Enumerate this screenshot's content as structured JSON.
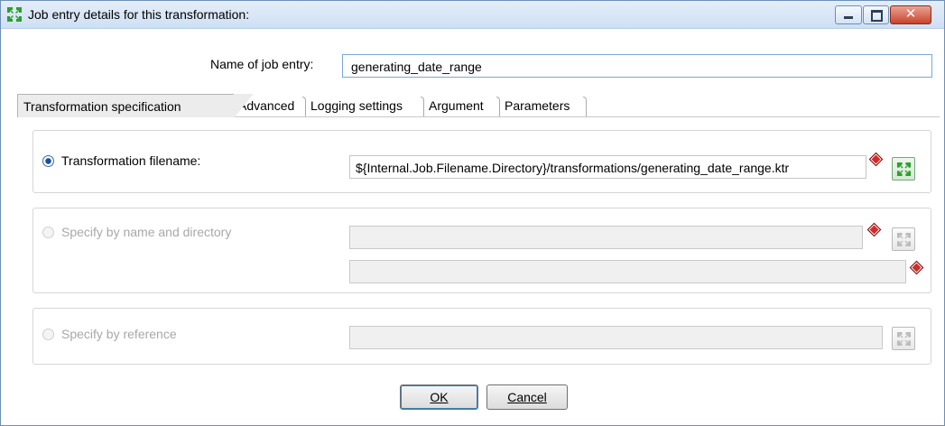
{
  "window": {
    "title": "Job entry details for this transformation:",
    "icon": "job-entry-icon",
    "controls": [
      "minimize-icon",
      "maximize-icon",
      "close-icon"
    ]
  },
  "name_of_job_entry": {
    "label": "Name of job entry:",
    "value": "generating_date_range"
  },
  "tabs": [
    {
      "label": "Transformation specification",
      "active": true
    },
    {
      "label": "Advanced",
      "active": false
    },
    {
      "label": "Logging settings",
      "active": false
    },
    {
      "label": "Argument",
      "active": false
    },
    {
      "label": "Parameters",
      "active": false
    }
  ],
  "spec": {
    "filename_option": {
      "label": "Transformation filename:",
      "selected": true,
      "value": "${Internal.Job.Filename.Directory}/transformations/generating_date_range.ktr"
    },
    "name_dir_option": {
      "label": "Specify by name and directory",
      "selected": false,
      "name_value": "",
      "directory_value": ""
    },
    "reference_option": {
      "label": "Specify by reference",
      "selected": false,
      "value": ""
    }
  },
  "buttons": {
    "ok": "OK",
    "cancel": "Cancel"
  },
  "colors": {
    "accent": "#3c7fb1",
    "icon_green": "#2e9e2e",
    "required_marker": "#d12a2a"
  }
}
